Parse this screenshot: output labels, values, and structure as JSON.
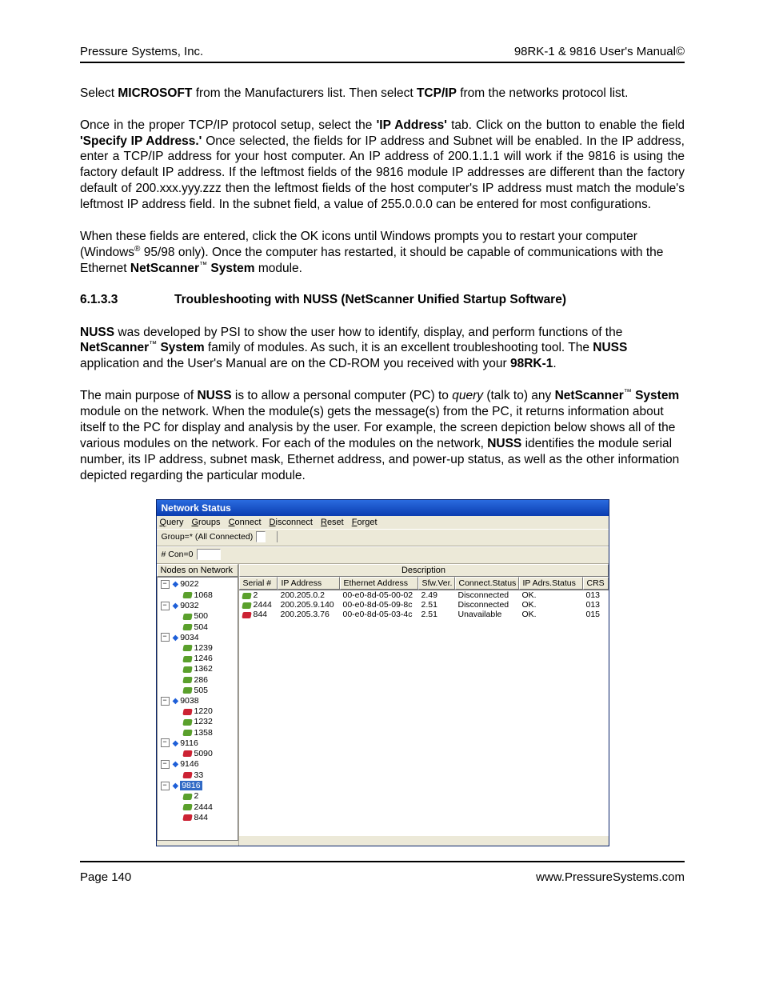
{
  "header": {
    "left": "Pressure Systems, Inc.",
    "right": "98RK-1 & 9816 User's Manual©"
  },
  "p1_a": "Select ",
  "p1_b": "MICROSOFT",
  "p1_c": " from the Manufacturers list.  Then select ",
  "p1_d": "TCP/IP",
  "p1_e": " from the networks protocol list.",
  "p2_a": "Once in the proper TCP/IP protocol setup, select the ",
  "p2_b": "'IP Address'",
  "p2_c": " tab.  Click on the button to enable the field ",
  "p2_d": "'Specify IP Address.'",
  "p2_e": "  Once selected, the fields for IP address and Subnet will be enabled.  In the IP address, enter a TCP/IP address for your host computer.  An IP address of 200.1.1.1 will work if the 9816 is using the factory default IP address.  If the leftmost fields of the 9816 module IP addresses are different than the factory default of 200.xxx.yyy.zzz then the leftmost fields of the host computer's IP address must match the module's leftmost IP address field.  In the  subnet field, a value of 255.0.0.0 can be entered for most configurations.",
  "p3_a": "When these fields are entered, click the OK icons until Windows prompts you to restart your computer (Windows",
  "p3_sup1": "®",
  "p3_b": " 95/98 only).  Once the computer has restarted, it should be capable of communications with the Ethernet ",
  "p3_c": "NetScanner",
  "p3_sup2": "™",
  "p3_d": " System",
  "p3_e": " module.",
  "sec_num": "6.1.3.3",
  "sec_title": "Troubleshooting with NUSS (NetScanner Unified Startup Software)",
  "p4_a": "NUSS",
  "p4_b": " was developed by PSI to show the user how to identify, display, and perform functions of the ",
  "p4_c": "NetScanner",
  "p4_sup": "™",
  "p4_d": " System",
  "p4_e": " family of modules.  As such, it is an excellent troubleshooting tool.  The ",
  "p4_f": "NUSS",
  "p4_g": " application and the User's Manual are on the CD-ROM you received with your ",
  "p4_h": "98RK-1",
  "p4_i": ".",
  "p5_a": "The main purpose of ",
  "p5_b": "NUSS",
  "p5_c": " is to allow a personal computer (PC) to ",
  "p5_d": "query",
  "p5_e": " (talk to) any ",
  "p5_f": "NetScanner",
  "p5_sup": "™",
  "p5_g": " System",
  "p5_h": " module on the network.  When the module(s) gets the message(s) from the PC, it returns information about itself to the PC for display and analysis by the user.  For example, the screen depiction below shows all of the various modules on the network.  For each of the modules on the network, ",
  "p5_i": "NUSS",
  "p5_j": " identifies the module serial number, its IP address, subnet mask, Ethernet address, and power-up status, as well as the other information depicted regarding the particular module.",
  "shot": {
    "title": "Network Status",
    "menu": [
      "Query",
      "Groups",
      "Connect",
      "Disconnect",
      "Reset",
      "Forget"
    ],
    "toolbar": {
      "group_label": "Group=* (All Connected)",
      "con_label": "# Con=0"
    },
    "left_head": "Nodes on Network",
    "right_head": "Description",
    "tree": [
      {
        "t": "p",
        "lvl": 0,
        "lbl": "9022"
      },
      {
        "t": "d",
        "lvl": 1,
        "lbl": "1068"
      },
      {
        "t": "p",
        "lvl": 0,
        "lbl": "9032"
      },
      {
        "t": "d",
        "lvl": 1,
        "lbl": "500"
      },
      {
        "t": "d",
        "lvl": 1,
        "lbl": "504"
      },
      {
        "t": "p",
        "lvl": 0,
        "lbl": "9034"
      },
      {
        "t": "d",
        "lvl": 1,
        "lbl": "1239"
      },
      {
        "t": "d",
        "lvl": 1,
        "lbl": "1246"
      },
      {
        "t": "d",
        "lvl": 1,
        "lbl": "1362"
      },
      {
        "t": "d",
        "lvl": 1,
        "lbl": "286"
      },
      {
        "t": "d",
        "lvl": 1,
        "lbl": "505"
      },
      {
        "t": "p",
        "lvl": 0,
        "lbl": "9038"
      },
      {
        "t": "r",
        "lvl": 1,
        "lbl": "1220"
      },
      {
        "t": "d",
        "lvl": 1,
        "lbl": "1232"
      },
      {
        "t": "d",
        "lvl": 1,
        "lbl": "1358"
      },
      {
        "t": "p",
        "lvl": 0,
        "lbl": "9116"
      },
      {
        "t": "r",
        "lvl": 1,
        "lbl": "5090"
      },
      {
        "t": "p",
        "lvl": 0,
        "lbl": "9146"
      },
      {
        "t": "r",
        "lvl": 1,
        "lbl": "33"
      },
      {
        "t": "ps",
        "lvl": 0,
        "lbl": "9816"
      },
      {
        "t": "d",
        "lvl": 1,
        "lbl": "2"
      },
      {
        "t": "d",
        "lvl": 1,
        "lbl": "2444"
      },
      {
        "t": "r",
        "lvl": 1,
        "lbl": "844"
      }
    ],
    "grid_head": [
      "Serial #",
      "IP Address",
      "Ethernet Address",
      "Sfw.Ver.",
      "Connect.Status",
      "IP Adrs.Status",
      "CRS"
    ],
    "grid_rows": [
      {
        "icon": "d",
        "serial": "2",
        "ip": "200.205.0.2",
        "eth": "00-e0-8d-05-00-02",
        "sw": "2.49",
        "conn": "Disconnected",
        "adrs": "OK.",
        "crs": "013"
      },
      {
        "icon": "d",
        "serial": "2444",
        "ip": "200.205.9.140",
        "eth": "00-e0-8d-05-09-8c",
        "sw": "2.51",
        "conn": "Disconnected",
        "adrs": "OK.",
        "crs": "013"
      },
      {
        "icon": "r",
        "serial": "844",
        "ip": "200.205.3.76",
        "eth": "00-e0-8d-05-03-4c",
        "sw": "2.51",
        "conn": "Unavailable",
        "adrs": "OK.",
        "crs": "015"
      }
    ]
  },
  "footer": {
    "left": "Page 140",
    "right": "www.PressureSystems.com"
  }
}
